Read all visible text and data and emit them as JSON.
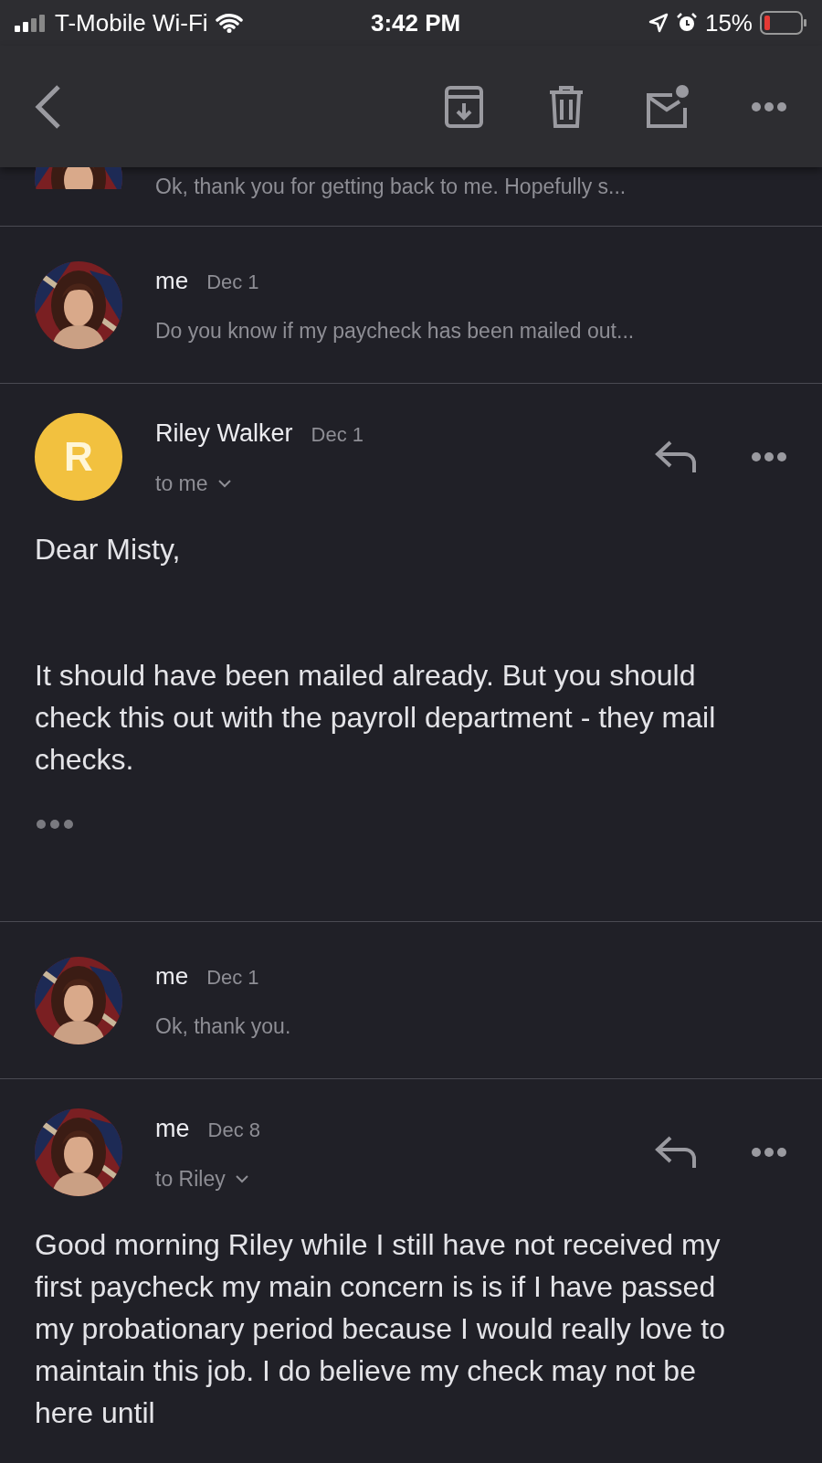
{
  "status_bar": {
    "carrier": "T-Mobile Wi-Fi",
    "time": "3:42 PM",
    "battery": "15%"
  },
  "messages": [
    {
      "kind": "collapsed",
      "partial": true,
      "avatar": {
        "kind": "picture"
      },
      "snippet": "Ok, thank you for getting back to me. Hopefully s..."
    },
    {
      "kind": "collapsed",
      "avatar": {
        "kind": "picture"
      },
      "sender": "me",
      "date": "Dec 1",
      "snippet": "Do you know if my paycheck has been mailed out..."
    },
    {
      "kind": "expanded",
      "avatar": {
        "kind": "initial",
        "initial": "R",
        "color": "#f2c13f"
      },
      "sender": "Riley Walker",
      "date": "Dec 1",
      "recipient": "to me",
      "trimmed": true,
      "body": [
        "Dear Misty,",
        "It should have been mailed already. But you should check this out with the payroll department - they mail checks."
      ]
    },
    {
      "kind": "collapsed",
      "avatar": {
        "kind": "picture"
      },
      "sender": "me",
      "date": "Dec 1",
      "snippet": "Ok, thank you."
    },
    {
      "kind": "expanded",
      "avatar": {
        "kind": "picture"
      },
      "sender": "me",
      "date": "Dec 8",
      "recipient": "to Riley",
      "trimmed": false,
      "body": [
        "Good morning Riley while I still have not received my first paycheck my main concern is is if I have passed my probationary period because I would really love to maintain this job. I do believe my check may not be here until"
      ]
    }
  ]
}
